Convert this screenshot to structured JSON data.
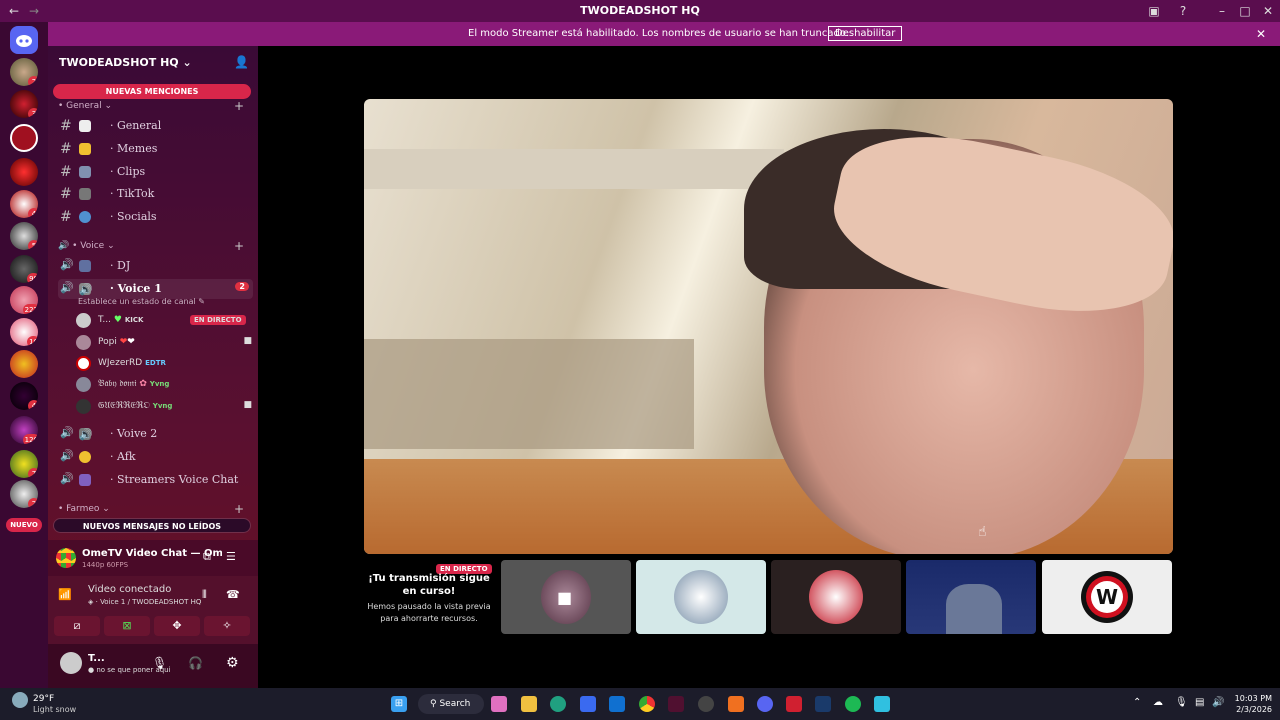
{
  "window": {
    "title": "TWODEADSHOT HQ"
  },
  "banner": {
    "text": "El modo Streamer está habilitado. Los nombres de usuario se han truncado.",
    "button": "Deshabilitar"
  },
  "rail": {
    "badges": [
      "2",
      "3",
      "4",
      "5",
      "98",
      "222",
      "16",
      "4",
      "126",
      "7",
      "2"
    ],
    "new_label": "NUEVO"
  },
  "sidebar": {
    "server_name": "TWODEADSHOT HQ",
    "mentions_pill": "NUEVAS MENCIONES",
    "unread_pill": "NUEVOS MENSAJES NO LEÍDOS",
    "cat_general": "• General",
    "cat_voice": "• Voice",
    "cat_farmeo": "• Farmeo",
    "text_channels": [
      "· General",
      "· Memes",
      "· Clips",
      "· TikTok",
      "· Socials"
    ],
    "voice_dj": "· DJ",
    "voice1": "· Voice 1",
    "voice1_badge": "2",
    "voice1_status": "Establece un estado de canal",
    "users": [
      {
        "name": "T...",
        "tag": "KICK",
        "live": "EN DIRECTO"
      },
      {
        "name": "Popi",
        "tag": ""
      },
      {
        "name": "WJezerRD",
        "tag": "EDTR"
      },
      {
        "name": "𝔅𝔞𝔟𝔶 𝔡𝔬𝔪𝔦",
        "tag": "Yvng"
      },
      {
        "name": "𝔊𝔘𝔈ℜℜ𝔈ℜ𝔒",
        "tag": "Yvng"
      }
    ],
    "voice_other": [
      "· Voive 2",
      "· Afk",
      "· Streamers Voice Chat"
    ]
  },
  "activity": {
    "title": "OmeTV Video Chat — Omegle R...",
    "sub": "1440p 60FPS"
  },
  "voice_conn": {
    "status": "Video conectado",
    "channel": "Voice 1 / TWODEADSHOT HQ"
  },
  "account": {
    "name": "T...",
    "status": "no se que poner aqui"
  },
  "stream": {
    "live": "EN DIRECTO",
    "title": "¡Tu transmisión sigue en curso!",
    "body": "Hemos pausado la vista previa para ahorrarte recursos."
  },
  "taskbar": {
    "weather_temp": "29°F",
    "weather_desc": "Light snow",
    "search": "Search",
    "time": "10:03 PM",
    "date": "2/3/2026"
  }
}
